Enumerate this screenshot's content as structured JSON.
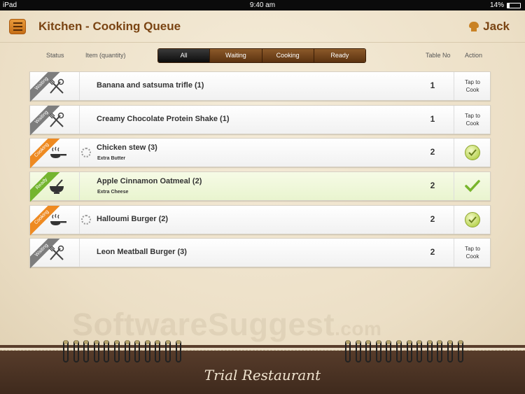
{
  "status_bar": {
    "device": "iPad",
    "time": "9:40 am",
    "battery": "14%"
  },
  "header": {
    "title": "Kitchen - Cooking Queue",
    "user": "Jack"
  },
  "columns": {
    "status": "Status",
    "item": "Item (quantity)",
    "table": "Table No",
    "action": "Action"
  },
  "filters": [
    "All",
    "Waiting",
    "Cooking",
    "Ready"
  ],
  "active_filter": "All",
  "orders": [
    {
      "status": "Waiting",
      "item": "Banana and satsuma trifle (1)",
      "note": "",
      "table": "1",
      "action_line1": "Tap to",
      "action_line2": "Cook"
    },
    {
      "status": "Waiting",
      "item": "Creamy Chocolate Protein Shake (1)",
      "note": "",
      "table": "1",
      "action_line1": "Tap to",
      "action_line2": "Cook"
    },
    {
      "status": "Cooking",
      "item": "Chicken stew (3)",
      "note": "Extra Butter",
      "table": "2",
      "action_line1": "",
      "action_line2": ""
    },
    {
      "status": "Ready",
      "item": "Apple Cinnamon Oatmeal (2)",
      "note": "Extra Cheese",
      "table": "2",
      "action_line1": "",
      "action_line2": ""
    },
    {
      "status": "Cooking",
      "item": "Halloumi Burger (2)",
      "note": "",
      "table": "2",
      "action_line1": "",
      "action_line2": ""
    },
    {
      "status": "Waiting",
      "item": "Leon Meatball Burger (3)",
      "note": "",
      "table": "2",
      "action_line1": "Tap to",
      "action_line2": "Cook"
    }
  ],
  "colors": {
    "waiting": "#7d7d7d",
    "cooking": "#ee8a21",
    "ready": "#74b52f",
    "accent": "#7a4413"
  },
  "watermark": {
    "main": "SoftwareSuggest",
    "suffix": ".com"
  },
  "footer": {
    "restaurant": "Trial Restaurant"
  }
}
